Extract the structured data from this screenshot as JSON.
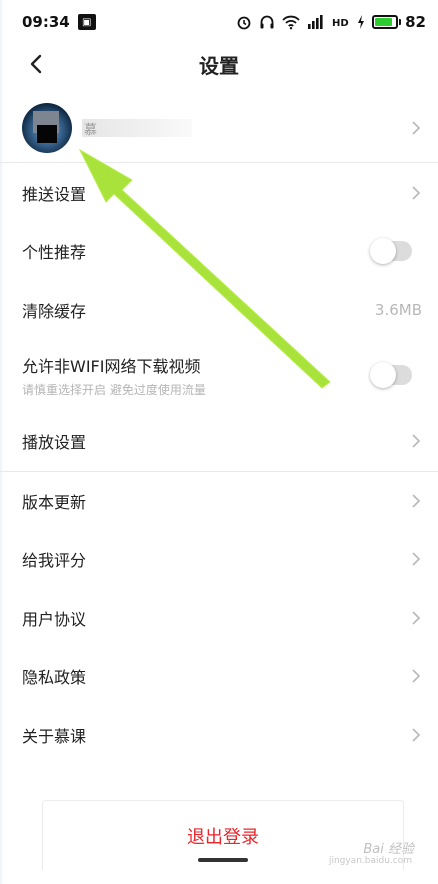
{
  "status_bar": {
    "time": "09:34",
    "battery": "82",
    "app_icon": "notification-app-icon"
  },
  "header": {
    "title": "设置",
    "back_icon": "chevron-left-icon"
  },
  "profile": {
    "name": "慕"
  },
  "settings": {
    "push_settings": "推送设置",
    "personal_recommend": "个性推荐",
    "personal_recommend_enabled": false,
    "clear_cache": "清除缓存",
    "cache_size": "3.6MB",
    "allow_non_wifi": "允许非WIFI网络下载视频",
    "allow_non_wifi_hint": "请慎重选择开启 避免过度使用流量",
    "allow_non_wifi_enabled": false,
    "playback_settings": "播放设置",
    "version_update": "版本更新",
    "rate_me": "给我评分",
    "user_agreement": "用户协议",
    "privacy_policy": "隐私政策",
    "about": "关于慕课"
  },
  "logout": {
    "label": "退出登录"
  },
  "watermark": {
    "text": "Bai 经验",
    "sub": "jingyan.baidu.com"
  },
  "colors": {
    "logout_text": "#e8262c",
    "arrow": "#a8e23a",
    "battery_fill": "#2ecc2e"
  }
}
